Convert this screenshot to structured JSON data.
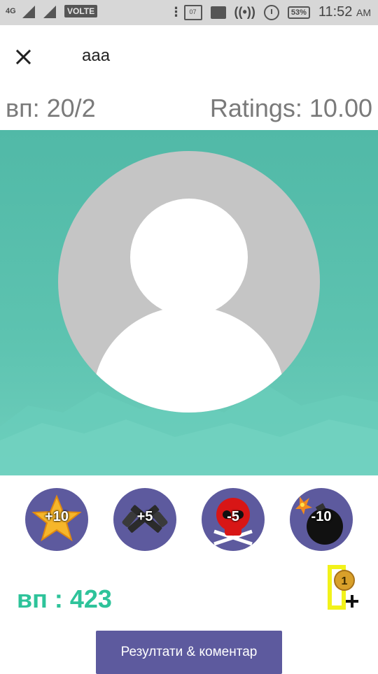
{
  "status_bar": {
    "network": "4G",
    "sim1": "1",
    "sim2": "2",
    "volte": "VOLTE",
    "calendar_day": "07",
    "battery": "53%",
    "time": "11:52",
    "ampm": "AM"
  },
  "header": {
    "title": "aaa",
    "close_icon": "close-icon"
  },
  "stats": {
    "vp": "вп: 20/2",
    "ratings": "Ratings: 10.00"
  },
  "actions": [
    {
      "label": "+10",
      "icon": "star-icon"
    },
    {
      "label": "+5",
      "icon": "crossed-revolvers-icon"
    },
    {
      "label": "-5",
      "icon": "skull-crossbones-icon"
    },
    {
      "label": "-10",
      "icon": "bomb-icon"
    }
  ],
  "points": {
    "label": "вп : 423"
  },
  "bonus": {
    "coin_text": "1",
    "icon": "add-coin-icon"
  },
  "results_button": {
    "label": "Резултати & коментар"
  },
  "colors": {
    "accent": "#5d5a9e",
    "hero": "#51b9a7",
    "points": "#2ec39a"
  }
}
